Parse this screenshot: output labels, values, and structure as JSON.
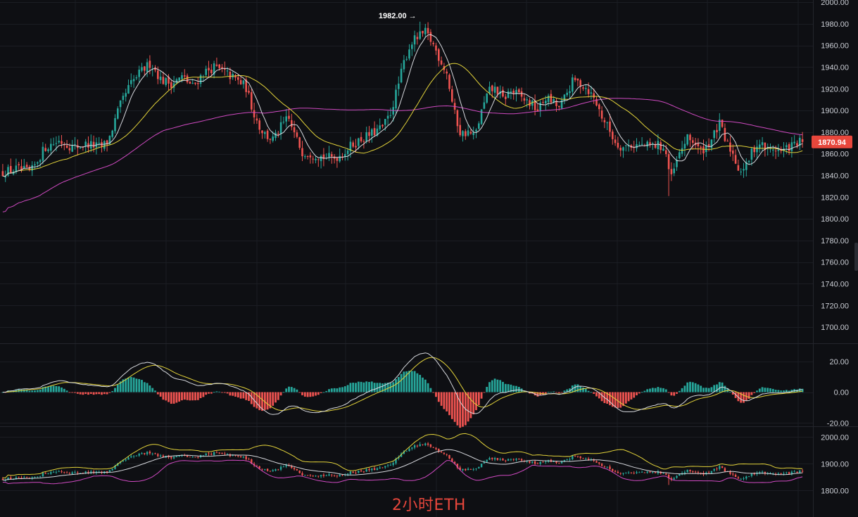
{
  "caption": "2小时ETH",
  "colors": {
    "background": "#0e0f13",
    "grid": "#1b1d23",
    "up": "#26a69a",
    "down": "#ef5350",
    "ma_white": "#d7d9de",
    "ma_yellow": "#e3d33a",
    "ma_pink": "#d04ac2",
    "macd_dif": "#d7d9de",
    "macd_dea": "#e3d33a",
    "price_tag": "#e8473c"
  },
  "chart_data": [
    {
      "type": "candlestick",
      "symbol": "ETH",
      "interval": "2h",
      "y_ticks": [
        "2000.00",
        "1980.00",
        "1960.00",
        "1940.00",
        "1920.00",
        "1900.00",
        "1880.00",
        "1860.00",
        "1840.00",
        "1820.00",
        "1800.00",
        "1780.00",
        "1760.00",
        "1740.00",
        "1720.00",
        "1700.00"
      ],
      "ylim": [
        1689,
        2002
      ],
      "last_price": "1870.94",
      "high_annotation": "1982.00 →",
      "candle_count": 300,
      "close_anchors": [
        [
          0,
          1843
        ],
        [
          20,
          1846
        ],
        [
          40,
          1843
        ],
        [
          60,
          1866
        ],
        [
          80,
          1872
        ],
        [
          100,
          1866
        ],
        [
          120,
          1869
        ],
        [
          140,
          1866
        ],
        [
          150,
          1872
        ],
        [
          165,
          1902
        ],
        [
          180,
          1923
        ],
        [
          195,
          1935
        ],
        [
          210,
          1944
        ],
        [
          225,
          1928
        ],
        [
          240,
          1925
        ],
        [
          255,
          1931
        ],
        [
          270,
          1922
        ],
        [
          285,
          1935
        ],
        [
          300,
          1940
        ],
        [
          315,
          1935
        ],
        [
          330,
          1929
        ],
        [
          345,
          1922
        ],
        [
          355,
          1900
        ],
        [
          365,
          1884
        ],
        [
          375,
          1876
        ],
        [
          385,
          1873
        ],
        [
          395,
          1885
        ],
        [
          405,
          1893
        ],
        [
          415,
          1876
        ],
        [
          425,
          1862
        ],
        [
          440,
          1860
        ],
        [
          455,
          1857
        ],
        [
          470,
          1856
        ],
        [
          482,
          1860
        ],
        [
          495,
          1868
        ],
        [
          510,
          1874
        ],
        [
          525,
          1879
        ],
        [
          540,
          1885
        ],
        [
          550,
          1897
        ],
        [
          560,
          1920
        ],
        [
          570,
          1946
        ],
        [
          580,
          1963
        ],
        [
          590,
          1968
        ],
        [
          600,
          1972
        ],
        [
          610,
          1962
        ],
        [
          620,
          1948
        ],
        [
          630,
          1935
        ],
        [
          640,
          1900
        ],
        [
          650,
          1878
        ],
        [
          660,
          1880
        ],
        [
          670,
          1876
        ],
        [
          680,
          1900
        ],
        [
          690,
          1918
        ],
        [
          700,
          1920
        ],
        [
          710,
          1910
        ],
        [
          720,
          1918
        ],
        [
          730,
          1915
        ],
        [
          740,
          1910
        ],
        [
          750,
          1906
        ],
        [
          760,
          1900
        ],
        [
          770,
          1912
        ],
        [
          780,
          1908
        ],
        [
          790,
          1902
        ],
        [
          800,
          1915
        ],
        [
          810,
          1928
        ],
        [
          820,
          1925
        ],
        [
          830,
          1920
        ],
        [
          840,
          1910
        ],
        [
          850,
          1895
        ],
        [
          860,
          1883
        ],
        [
          870,
          1870
        ],
        [
          880,
          1866
        ],
        [
          890,
          1868
        ],
        [
          900,
          1868
        ],
        [
          915,
          1867
        ],
        [
          930,
          1868
        ],
        [
          940,
          1865
        ],
        [
          948,
          1835
        ],
        [
          955,
          1850
        ],
        [
          962,
          1862
        ],
        [
          970,
          1874
        ],
        [
          980,
          1872
        ],
        [
          990,
          1862
        ],
        [
          1000,
          1868
        ],
        [
          1010,
          1878
        ],
        [
          1018,
          1888
        ],
        [
          1025,
          1872
        ],
        [
          1035,
          1862
        ],
        [
          1045,
          1845
        ],
        [
          1055,
          1848
        ],
        [
          1065,
          1865
        ],
        [
          1075,
          1870
        ],
        [
          1085,
          1863
        ],
        [
          1095,
          1865
        ],
        [
          1105,
          1862
        ],
        [
          1115,
          1866
        ],
        [
          1125,
          1869
        ],
        [
          1133,
          1871
        ]
      ],
      "moving_averages": [
        "white",
        "yellow",
        "pink"
      ]
    },
    {
      "type": "macd",
      "y_ticks": [
        "20.00",
        "0.00",
        "-20.00"
      ],
      "ylim": [
        -24,
        24
      ],
      "series": [
        "histogram",
        "dif",
        "dea"
      ]
    },
    {
      "type": "line",
      "y_ticks": [
        "2000.00",
        "1900.00",
        "1800.00"
      ],
      "ylim": [
        1780,
        2025
      ],
      "series": [
        "yellow",
        "white",
        "pink"
      ]
    }
  ]
}
